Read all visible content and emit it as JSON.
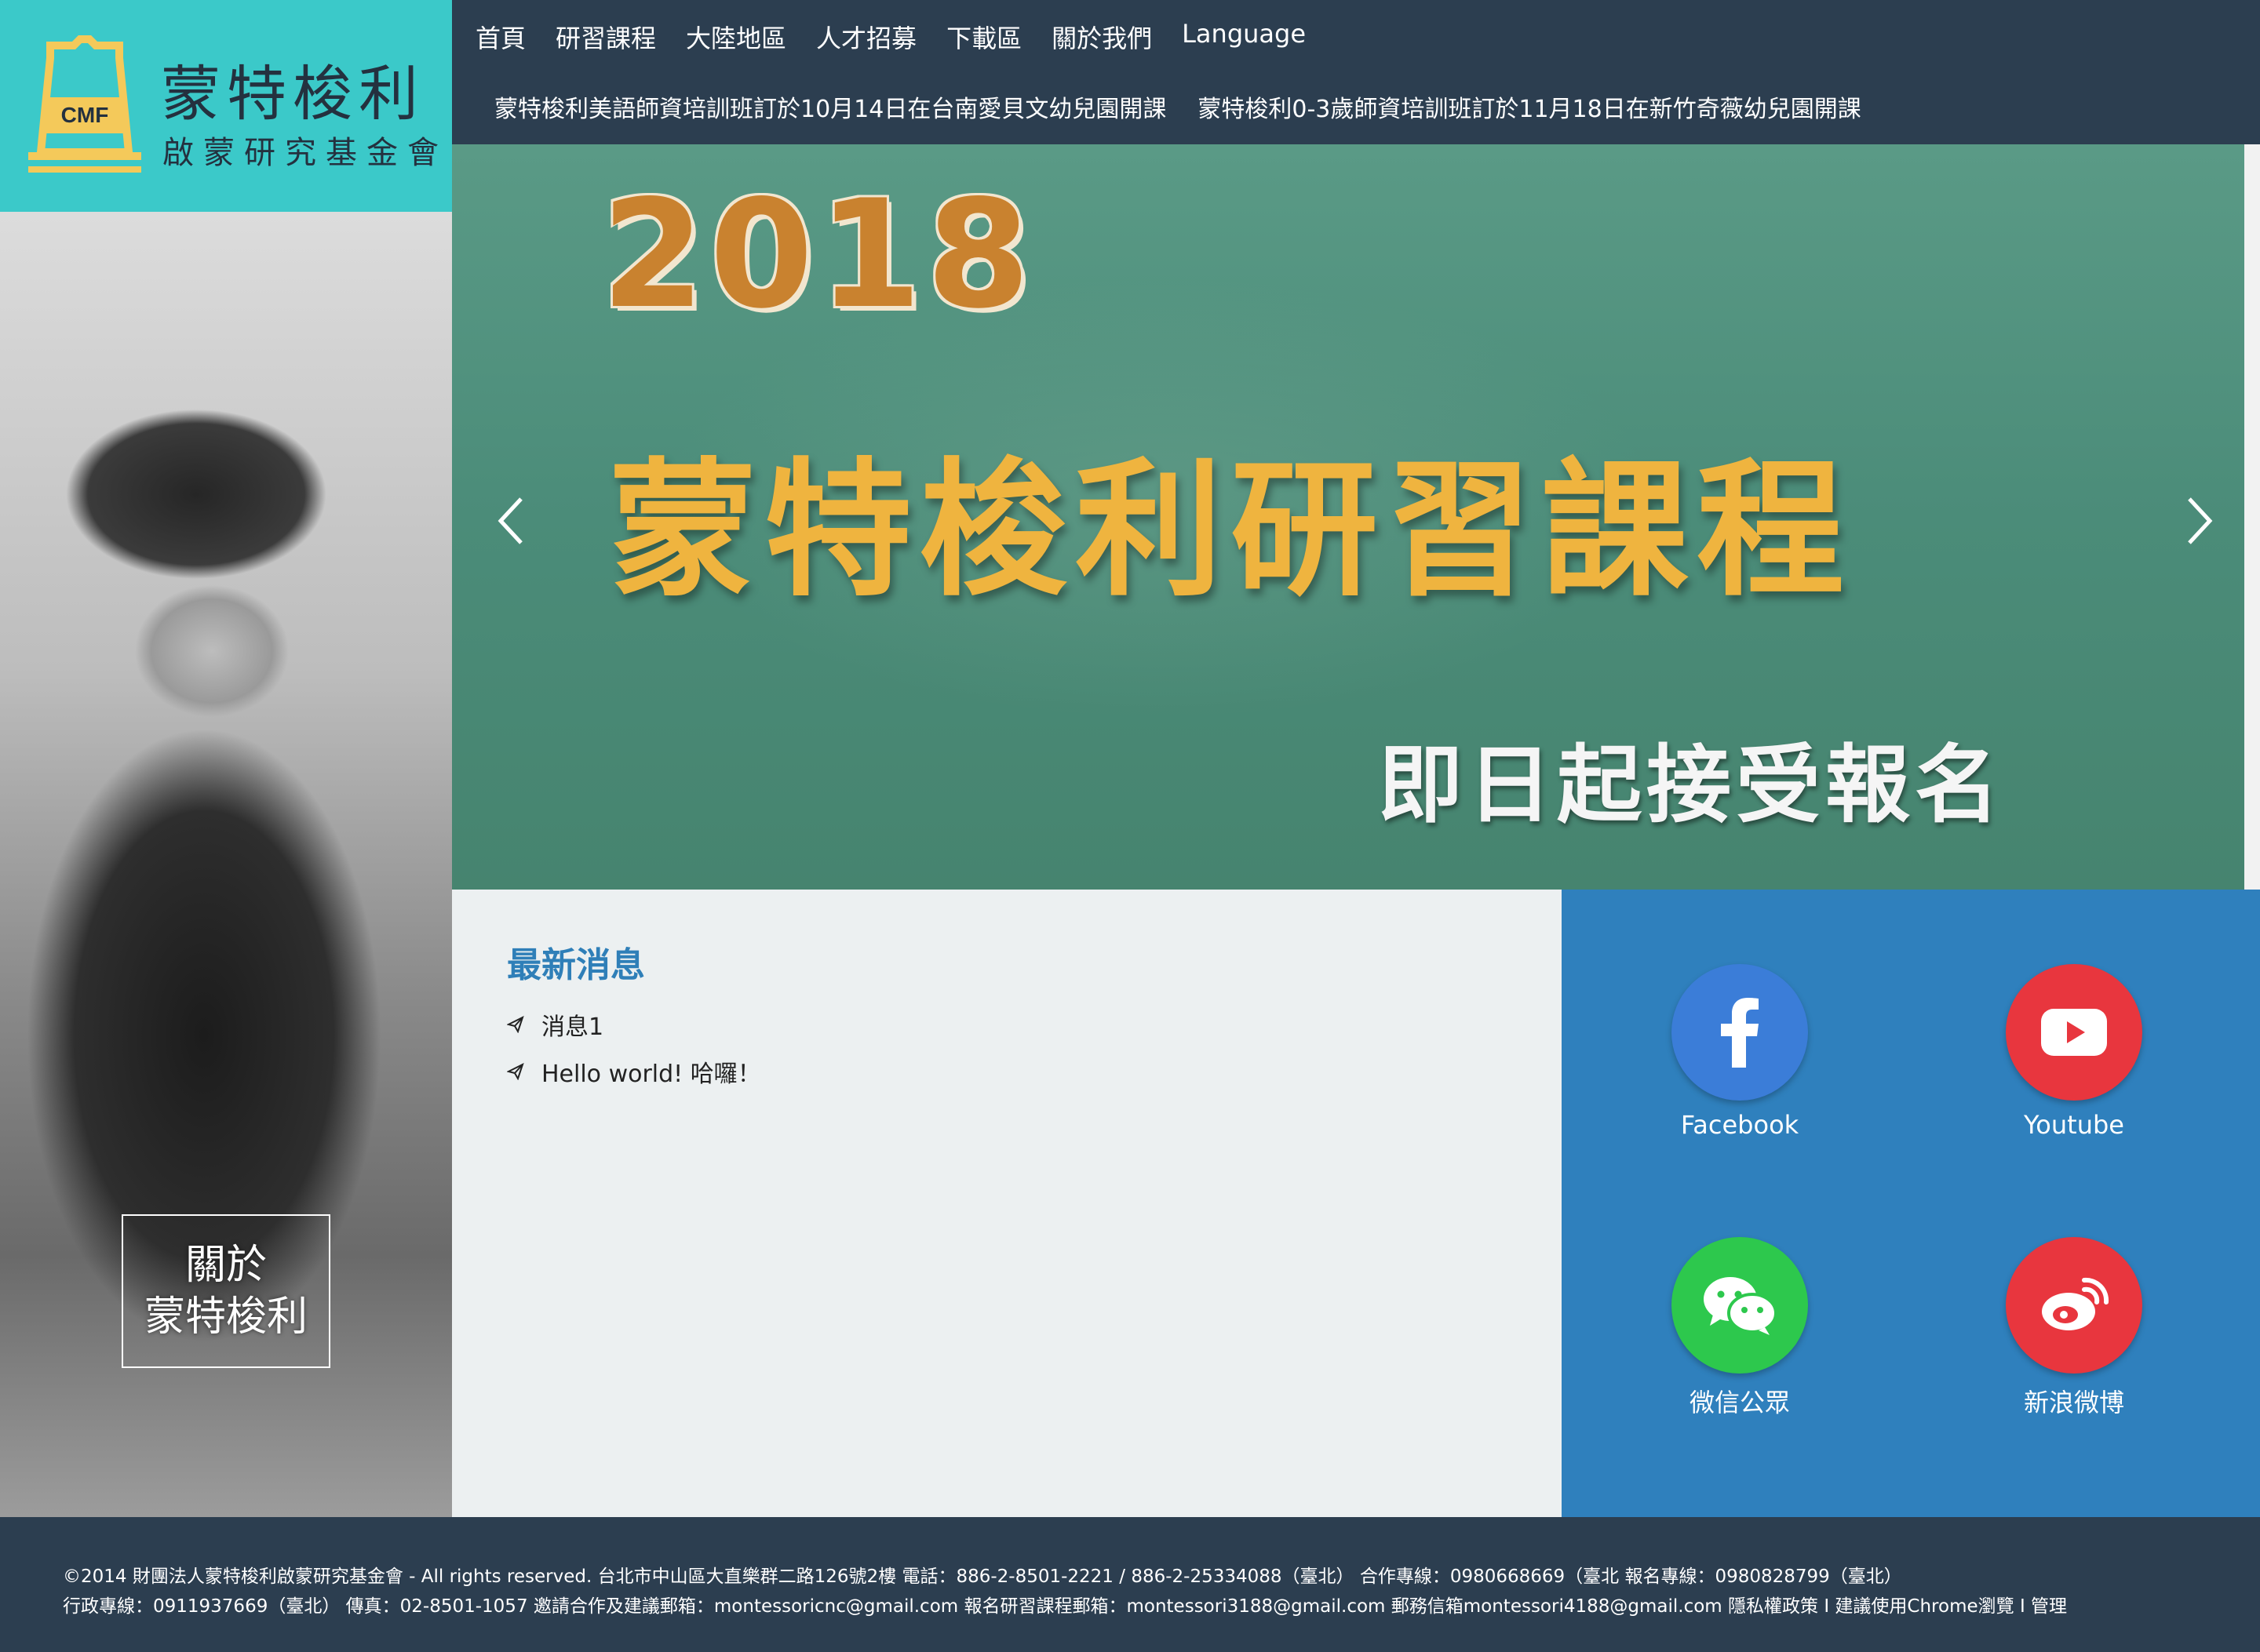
{
  "logo": {
    "badge": "CMF",
    "title": "蒙特梭利",
    "subtitle": "啟蒙研究基金會"
  },
  "nav": {
    "items": [
      {
        "label": "首頁"
      },
      {
        "label": "研習課程"
      },
      {
        "label": "大陸地區"
      },
      {
        "label": "人才招募"
      },
      {
        "label": "下載區"
      },
      {
        "label": "關於我們"
      },
      {
        "label": "Language"
      }
    ]
  },
  "ticker": {
    "items": [
      "蒙特梭利美語師資培訓班訂於10月14日在台南愛貝文幼兒園開課",
      "蒙特梭利0-3歲師資培訓班訂於11月18日在新竹奇薇幼兒園開課"
    ]
  },
  "about": {
    "line1": "關於",
    "line2": "蒙特梭利"
  },
  "hero": {
    "year": "2018",
    "headline": "蒙特梭利研習課程",
    "signup": "即日起接受報名"
  },
  "news": {
    "title": "最新消息",
    "items": [
      "消息1",
      "Hello world! 哈囉！"
    ]
  },
  "social": {
    "items": [
      {
        "label": "Facebook",
        "icon": "facebook-icon",
        "color": "#3b7dd8"
      },
      {
        "label": "Youtube",
        "icon": "youtube-icon",
        "color": "#e8363e"
      },
      {
        "label": "微信公眾",
        "icon": "wechat-icon",
        "color": "#2dc84d"
      },
      {
        "label": "新浪微博",
        "icon": "weibo-icon",
        "color": "#e8363e"
      }
    ]
  },
  "footer": {
    "line1": "©2014 財團法人蒙特梭利啟蒙研究基金會 - All rights reserved.    台北市中山區大直樂群二路126號2樓    電話：886-2-8501-2221 / 886-2-25334088（臺北）   合作專線：0980668669（臺北    報名專線：0980828799（臺北）",
    "line2_text": "行政專線：0911937669（臺北）   傳真：02-8501-1057    邀請合作及建議郵箱：montessoricnc@gmail.com    報名研習課程郵箱：montessori3188@gmail.com    郵務信箱montessori4188@gmail.com    ",
    "privacy": "隱私權政策",
    "sep": " I ",
    "browser_note": "建議使用Chrome瀏覽",
    "admin": "管理"
  },
  "colors": {
    "logo_bg": "#3bc9c9",
    "nav_bg": "#2c3e50",
    "news_bg": "#ecf0f1",
    "news_title": "#2f7fb8",
    "social_bg": "#2f80bd",
    "hero_year": "#c9822f",
    "hero_headline": "#efb43f"
  }
}
